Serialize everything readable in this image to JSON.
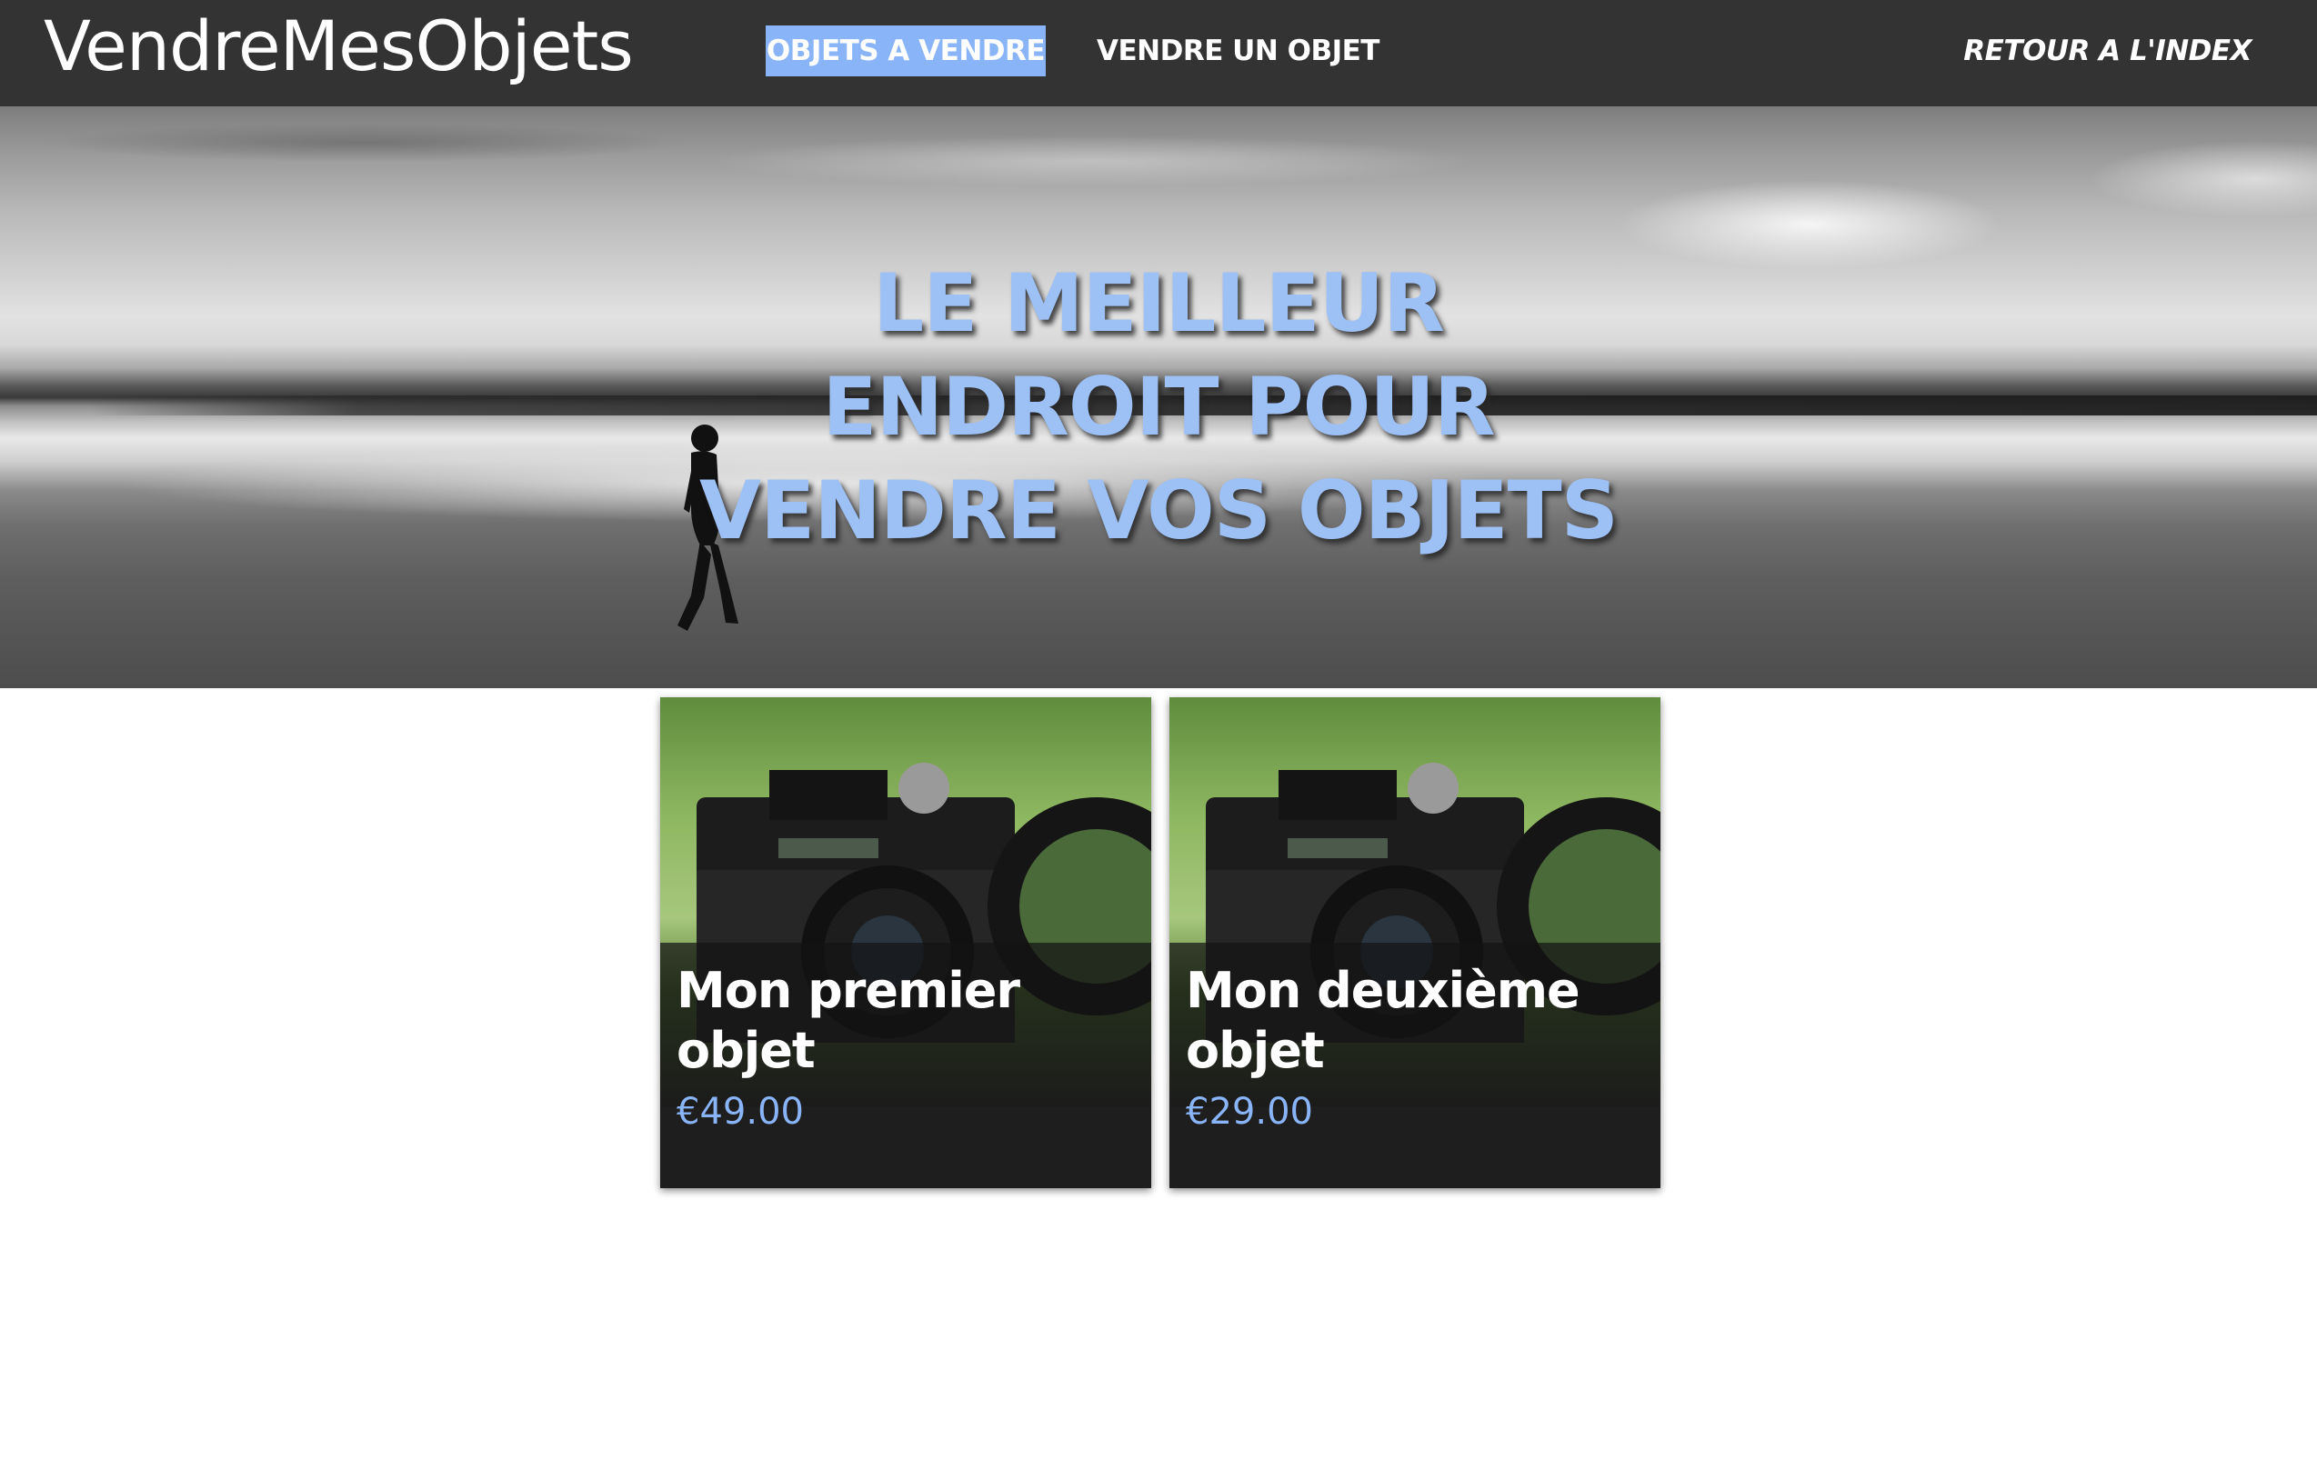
{
  "navbar": {
    "brand": "VendreMesObjets",
    "links": [
      {
        "label": "OBJETS A VENDRE",
        "active": true
      },
      {
        "label": "VENDRE UN OBJET",
        "active": false
      },
      {
        "label": "RETOUR A L'INDEX",
        "active": false
      }
    ]
  },
  "hero": {
    "lines": [
      "LE MEILLEUR",
      "ENDROIT POUR",
      "VENDRE VOS OBJETS"
    ]
  },
  "products": [
    {
      "title": "Mon premier objet",
      "price": "€49.00"
    },
    {
      "title": "Mon deuxième objet",
      "price": "€29.00"
    }
  ],
  "colors": {
    "navbar_bg": "#333333",
    "accent": "#8ab4f8",
    "hero_text": "#9dc0f5"
  }
}
